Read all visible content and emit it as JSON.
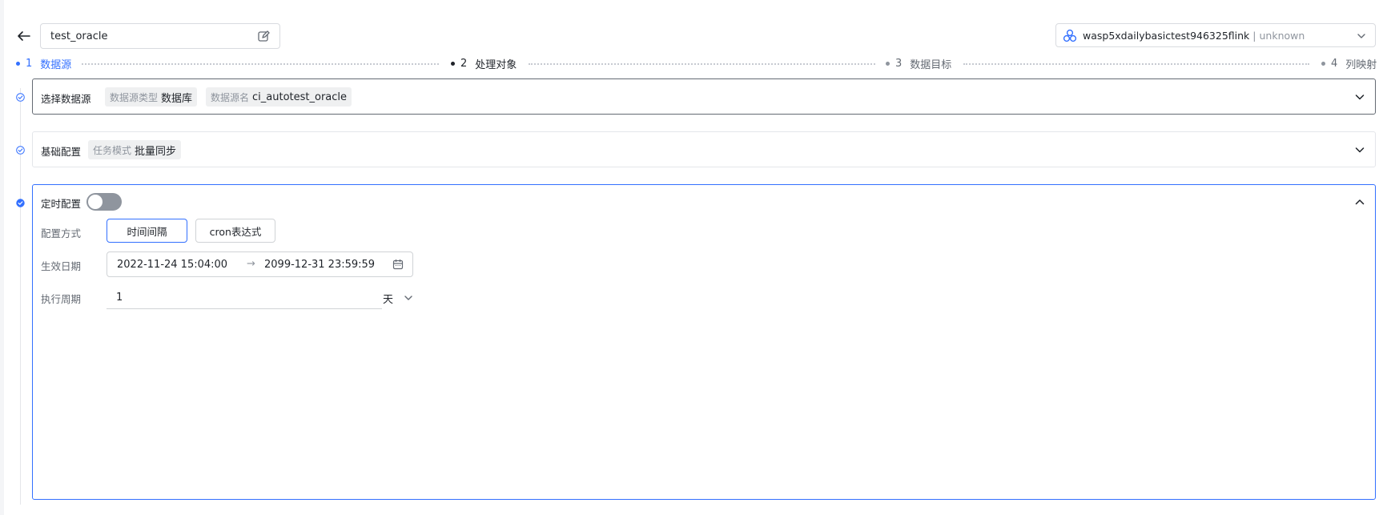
{
  "header": {
    "task_name": "test_oracle",
    "engine_name": "wasp5xdailybasictest946325flink",
    "engine_status": "unknown"
  },
  "steps": [
    {
      "num": "1",
      "label": "数据源",
      "state": "active"
    },
    {
      "num": "2",
      "label": "处理对象",
      "state": "done"
    },
    {
      "num": "3",
      "label": "数据目标",
      "state": "todo"
    },
    {
      "num": "4",
      "label": "列映射",
      "state": "todo"
    }
  ],
  "datasource_section": {
    "title": "选择数据源",
    "tags": [
      {
        "key": "数据源类型",
        "value": "数据库"
      },
      {
        "key": "数据源名",
        "value": "ci_autotest_oracle"
      }
    ]
  },
  "basic_section": {
    "title": "基础配置",
    "tags": [
      {
        "key": "任务模式",
        "value": "批量同步"
      }
    ]
  },
  "schedule_section": {
    "title": "定时配置",
    "enabled": false,
    "config_mode_label": "配置方式",
    "modes": [
      "时间间隔",
      "cron表达式"
    ],
    "selected_mode": "时间间隔",
    "effective_date_label": "生效日期",
    "start_date": "2022-11-24 15:04:00",
    "range_separator": "→",
    "end_date": "2099-12-31 23:59:59",
    "period_label": "执行周期",
    "period_value": "1",
    "period_unit": "天"
  },
  "colors": {
    "primary": "#3370ff",
    "text": "#1f2329",
    "muted": "#8f959e",
    "border": "#e4e6ea"
  }
}
